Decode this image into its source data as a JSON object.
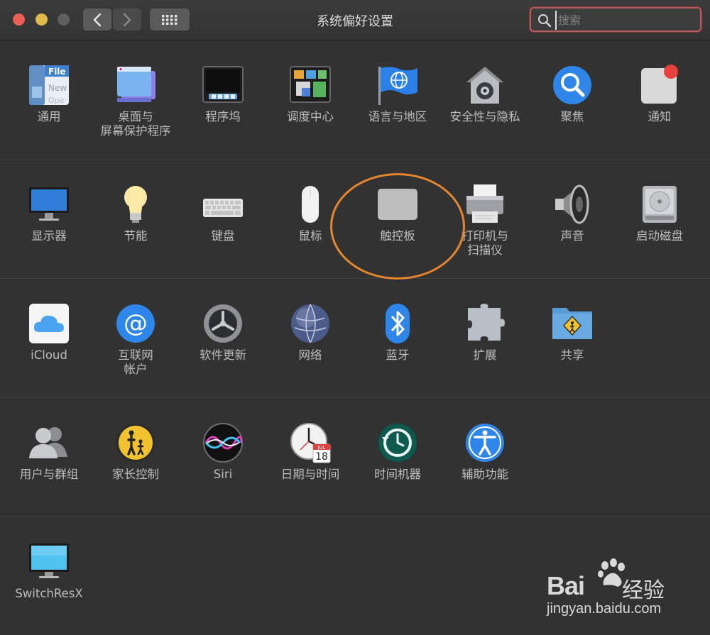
{
  "window": {
    "title": "系统偏好设置"
  },
  "search": {
    "placeholder": "搜索",
    "value": ""
  },
  "colors": {
    "close": "#ec5f57",
    "minimize": "#e0b94a",
    "zoom_disabled": "#5f5f5f",
    "highlight_ring": "#e5862f",
    "search_focus": "#b85a5e"
  },
  "rows": [
    [
      {
        "label": "通用",
        "icon": "general-icon"
      },
      {
        "label": "桌面与\n屏幕保护程序",
        "icon": "desktop-screensaver-icon"
      },
      {
        "label": "程序坞",
        "icon": "dock-icon"
      },
      {
        "label": "调度中心",
        "icon": "mission-control-icon"
      },
      {
        "label": "语言与地区",
        "icon": "language-region-icon"
      },
      {
        "label": "安全性与隐私",
        "icon": "security-privacy-icon"
      },
      {
        "label": "聚焦",
        "icon": "spotlight-icon"
      },
      {
        "label": "通知",
        "icon": "notifications-icon"
      }
    ],
    [
      {
        "label": "显示器",
        "icon": "displays-icon"
      },
      {
        "label": "节能",
        "icon": "energy-saver-icon"
      },
      {
        "label": "键盘",
        "icon": "keyboard-icon"
      },
      {
        "label": "鼠标",
        "icon": "mouse-icon"
      },
      {
        "label": "触控板",
        "icon": "trackpad-icon"
      },
      {
        "label": "打印机与\n扫描仪",
        "icon": "printers-scanners-icon"
      },
      {
        "label": "声音",
        "icon": "sound-icon"
      },
      {
        "label": "启动磁盘",
        "icon": "startup-disk-icon"
      }
    ],
    [
      {
        "label": "iCloud",
        "icon": "icloud-icon"
      },
      {
        "label": "互联网\n帐户",
        "icon": "internet-accounts-icon"
      },
      {
        "label": "软件更新",
        "icon": "software-update-icon"
      },
      {
        "label": "网络",
        "icon": "network-icon"
      },
      {
        "label": "蓝牙",
        "icon": "bluetooth-icon"
      },
      {
        "label": "扩展",
        "icon": "extensions-icon"
      },
      {
        "label": "共享",
        "icon": "sharing-icon"
      }
    ],
    [
      {
        "label": "用户与群组",
        "icon": "users-groups-icon"
      },
      {
        "label": "家长控制",
        "icon": "parental-controls-icon"
      },
      {
        "label": "Siri",
        "icon": "siri-icon"
      },
      {
        "label": "日期与时间",
        "icon": "date-time-icon"
      },
      {
        "label": "时间机器",
        "icon": "time-machine-icon"
      },
      {
        "label": "辅助功能",
        "icon": "accessibility-icon"
      }
    ],
    [
      {
        "label": "SwitchResX",
        "icon": "switchresx-icon"
      }
    ]
  ],
  "date_time_icon": {
    "month": "JUL",
    "day": "18"
  },
  "watermark": {
    "brand": "Bai",
    "brand_tail": "经验",
    "url": "jingyan.baidu.com"
  }
}
